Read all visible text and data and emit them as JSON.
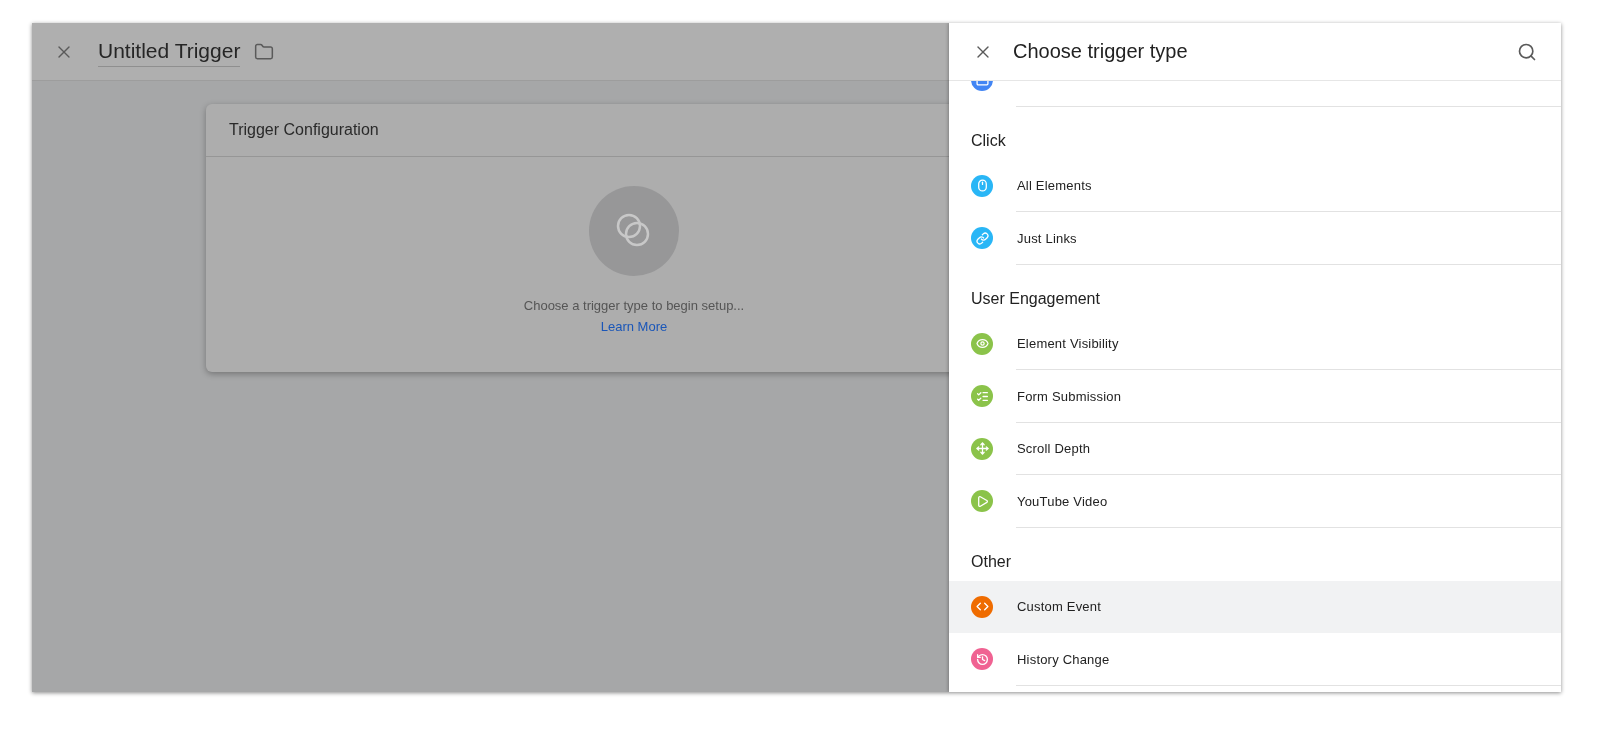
{
  "editor": {
    "title": "Untitled Trigger"
  },
  "card": {
    "title": "Trigger Configuration",
    "message": "Choose a trigger type to begin setup...",
    "link": "Learn More"
  },
  "panel": {
    "title": "Choose trigger type",
    "sections": [
      {
        "items": [
          {
            "kind": "window",
            "color": "#4285f4",
            "selected": false
          }
        ]
      },
      {
        "heading": "Click",
        "items": [
          {
            "label": "All Elements",
            "kind": "mouse",
            "color": "#29b6f6",
            "selected": false
          },
          {
            "label": "Just Links",
            "kind": "link",
            "color": "#29b6f6",
            "selected": false
          }
        ]
      },
      {
        "heading": "User Engagement",
        "items": [
          {
            "label": "Element Visibility",
            "kind": "eye",
            "color": "#8bc34a",
            "selected": false
          },
          {
            "label": "Form Submission",
            "kind": "form",
            "color": "#8bc34a",
            "selected": false
          },
          {
            "label": "Scroll Depth",
            "kind": "scroll",
            "color": "#8bc34a",
            "selected": false
          },
          {
            "label": "YouTube Video",
            "kind": "play",
            "color": "#8bc34a",
            "selected": false
          }
        ]
      },
      {
        "heading": "Other",
        "items": [
          {
            "label": "Custom Event",
            "kind": "code",
            "color": "#ef6c00",
            "selected": true
          },
          {
            "label": "History Change",
            "kind": "history",
            "color": "#f06292",
            "selected": false
          }
        ]
      }
    ]
  }
}
